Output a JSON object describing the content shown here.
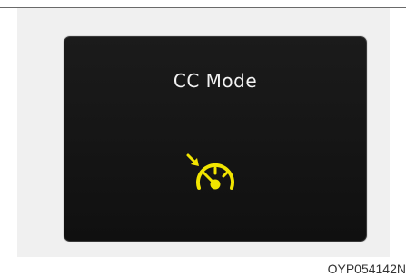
{
  "display": {
    "title": "CC Mode",
    "icon": "cruise-control-speedometer-icon",
    "icon_color": "#f2e500"
  },
  "figure": {
    "code": "OYP054142N"
  }
}
